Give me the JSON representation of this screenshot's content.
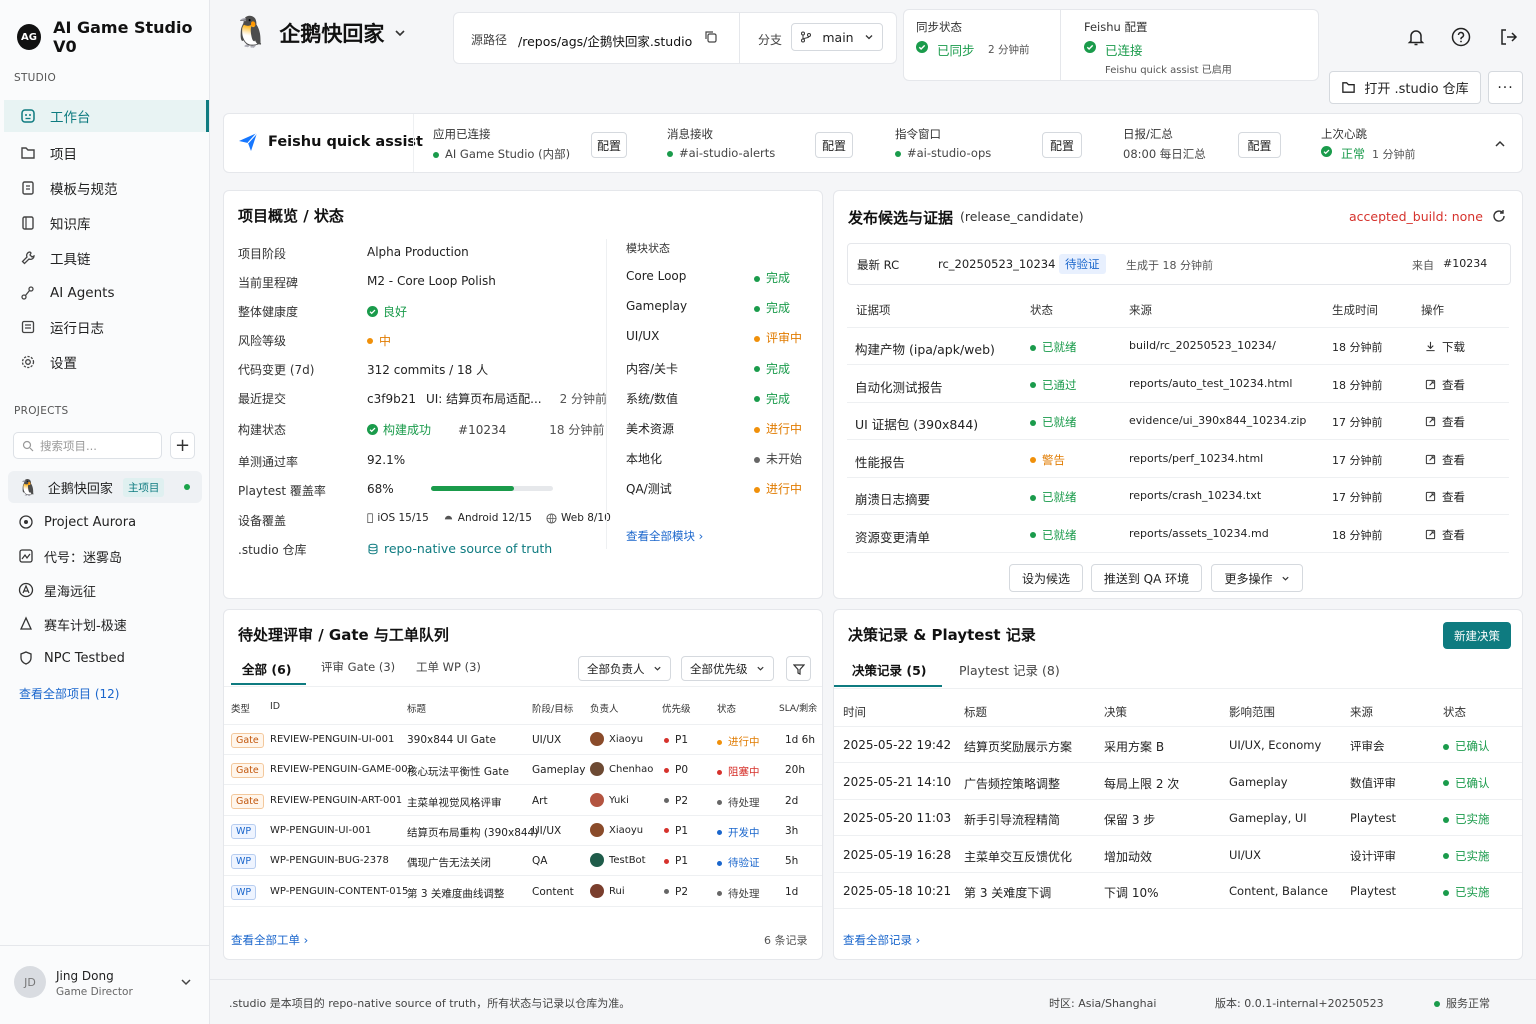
{
  "brand": {
    "logo": "AG",
    "name": "AI Game Studio V0"
  },
  "sidebar": {
    "studio_label": "STUDIO",
    "items": [
      {
        "label": "工作台",
        "icon": "dashboard-icon"
      },
      {
        "label": "项目",
        "icon": "folder-icon"
      },
      {
        "label": "模板与规范",
        "icon": "template-icon"
      },
      {
        "label": "知识库",
        "icon": "book-icon"
      },
      {
        "label": "工具链",
        "icon": "wrench-icon"
      },
      {
        "label": "AI Agents",
        "icon": "agent-icon"
      },
      {
        "label": "运行日志",
        "icon": "log-icon"
      },
      {
        "label": "设置",
        "icon": "gear-icon"
      }
    ],
    "projects_label": "PROJECTS",
    "search_placeholder": "搜索项目...",
    "projects": [
      {
        "name": "企鹅快回家",
        "tag": "主项目"
      },
      {
        "name": "Project Aurora"
      },
      {
        "name": "代号：迷雾岛"
      },
      {
        "name": "星海远征"
      },
      {
        "name": "赛车计划-极速"
      },
      {
        "name": "NPC Testbed"
      }
    ],
    "view_all": "查看全部项目 (12)",
    "user": {
      "initials": "JD",
      "name": "Jing Dong",
      "role": "Game Director"
    }
  },
  "header": {
    "project_title": "企鹅快回家",
    "source_label": "源路径",
    "source_path": "/repos/ags/企鹅快回家.studio",
    "branch_label": "分支",
    "branch": "main",
    "sync": {
      "label": "同步状态",
      "status": "已同步",
      "time": "2 分钟前"
    },
    "feishu": {
      "label": "Feishu 配置",
      "status": "已连接",
      "sub": "Feishu quick assist 已启用"
    },
    "open_repo": "打开 .studio 仓库"
  },
  "feishu_bar": {
    "title": "Feishu quick assist",
    "config_label": "配置",
    "items": [
      {
        "label": "应用已连接",
        "value": "AI Game Studio (内部)"
      },
      {
        "label": "消息接收",
        "value": "#ai-studio-alerts"
      },
      {
        "label": "指令窗口",
        "value": "#ai-studio-ops"
      },
      {
        "label": "日报/汇总",
        "value": "08:00 每日汇总"
      }
    ],
    "heartbeat": {
      "label": "上次心跳",
      "status": "正常",
      "time": "1 分钟前"
    }
  },
  "overview": {
    "title": "项目概览 / 状态",
    "rows": [
      {
        "k": "项目阶段",
        "v": "Alpha Production"
      },
      {
        "k": "当前里程碑",
        "v": "M2 - Core Loop Polish"
      },
      {
        "k": "整体健康度",
        "v": "良好"
      },
      {
        "k": "风险等级",
        "v": "中"
      },
      {
        "k": "代码变更 (7d)",
        "v": "312 commits / 18 人"
      },
      {
        "k": "最近提交",
        "v": "c3f9b21",
        "v2": "UI: 结算页布局适配...",
        "v3": "2 分钟前"
      },
      {
        "k": "构建状态",
        "v": "构建成功",
        "v2": "#10234",
        "v3": "18 分钟前"
      },
      {
        "k": "单测通过率",
        "v": "92.1%"
      },
      {
        "k": "Playtest 覆盖率",
        "v": "68%",
        "progress": 0.68
      },
      {
        "k": "设备覆盖",
        "v": "iOS 15/15",
        "v2": "Android 12/15",
        "v3": "Web 8/10"
      },
      {
        "k": ".studio 仓库",
        "v": "repo-native source of truth"
      }
    ],
    "modules_label": "模块状态",
    "modules": [
      {
        "name": "Core Loop",
        "status": "完成",
        "c": "green"
      },
      {
        "name": "Gameplay",
        "status": "完成",
        "c": "green"
      },
      {
        "name": "UI/UX",
        "status": "评审中",
        "c": "orange"
      },
      {
        "name": "内容/关卡",
        "status": "完成",
        "c": "green"
      },
      {
        "name": "系统/数值",
        "status": "完成",
        "c": "green"
      },
      {
        "name": "美术资源",
        "status": "进行中",
        "c": "orange"
      },
      {
        "name": "本地化",
        "status": "未开始",
        "c": "grey"
      },
      {
        "name": "QA/测试",
        "status": "进行中",
        "c": "orange"
      }
    ],
    "view_modules": "查看全部模块"
  },
  "release": {
    "title": "发布候选与证据",
    "title_sub": "(release_candidate)",
    "accepted": "accepted_build: none",
    "rc_label": "最新 RC",
    "rc_id": "rc_20250523_10234",
    "rc_badge": "待验证",
    "rc_gen": "生成于 18 分钟前",
    "rc_from": "来自",
    "rc_build": "#10234",
    "headers": [
      "证据项",
      "状态",
      "来源",
      "生成时间",
      "操作"
    ],
    "rows": [
      {
        "item": "构建产物 (ipa/apk/web)",
        "status": "已就绪",
        "c": "green",
        "src": "build/rc_20250523_10234/",
        "time": "18 分钟前",
        "op": "下载"
      },
      {
        "item": "自动化测试报告",
        "status": "已通过",
        "c": "green",
        "src": "reports/auto_test_10234.html",
        "time": "18 分钟前",
        "op": "查看"
      },
      {
        "item": "UI 证据包 (390x844)",
        "status": "已就绪",
        "c": "green",
        "src": "evidence/ui_390x844_10234.zip",
        "time": "17 分钟前",
        "op": "查看"
      },
      {
        "item": "性能报告",
        "status": "警告",
        "c": "orange",
        "src": "reports/perf_10234.html",
        "time": "17 分钟前",
        "op": "查看"
      },
      {
        "item": "崩溃日志摘要",
        "status": "已就绪",
        "c": "green",
        "src": "reports/crash_10234.txt",
        "time": "17 分钟前",
        "op": "查看"
      },
      {
        "item": "资源变更清单",
        "status": "已就绪",
        "c": "green",
        "src": "reports/assets_10234.md",
        "time": "18 分钟前",
        "op": "查看"
      }
    ],
    "btn_candidate": "设为候选",
    "btn_push": "推送到 QA 环境",
    "btn_more": "更多操作"
  },
  "queue": {
    "title": "待处理评审 / Gate 与工单队列",
    "tabs": [
      "全部 (6)",
      "评审 Gate (3)",
      "工单 WP (3)"
    ],
    "filter_owner": "全部负责人",
    "filter_priority": "全部优先级",
    "headers": [
      "类型",
      "ID",
      "标题",
      "阶段/目标",
      "负责人",
      "优先级",
      "状态",
      "SLA/剩余"
    ],
    "rows": [
      {
        "type": "Gate",
        "id": "REVIEW-PENGUIN-UI-001",
        "title": "390x844 UI Gate",
        "stage": "UI/UX",
        "owner": "Xiaoyu",
        "pri": "P1",
        "pc": "red",
        "status": "进行中",
        "sc": "orange",
        "sla": "1d 6h"
      },
      {
        "type": "Gate",
        "id": "REVIEW-PENGUIN-GAME-002",
        "title": "核心玩法平衡性 Gate",
        "stage": "Gameplay",
        "owner": "Chenhao",
        "pri": "P0",
        "pc": "red",
        "status": "阻塞中",
        "sc": "red",
        "sla": "20h"
      },
      {
        "type": "Gate",
        "id": "REVIEW-PENGUIN-ART-001",
        "title": "主菜单视觉风格评审",
        "stage": "Art",
        "owner": "Yuki",
        "pri": "P2",
        "pc": "grey",
        "status": "待处理",
        "sc": "grey",
        "sla": "2d"
      },
      {
        "type": "WP",
        "id": "WP-PENGUIN-UI-001",
        "title": "结算页布局重构 (390x844)",
        "stage": "UI/UX",
        "owner": "Xiaoyu",
        "pri": "P1",
        "pc": "red",
        "status": "开发中",
        "sc": "blue",
        "sla": "3h"
      },
      {
        "type": "WP",
        "id": "WP-PENGUIN-BUG-2378",
        "title": "偶现广告无法关闭",
        "stage": "QA",
        "owner": "TestBot",
        "pri": "P1",
        "pc": "red",
        "status": "待验证",
        "sc": "blue",
        "sla": "5h"
      },
      {
        "type": "WP",
        "id": "WP-PENGUIN-CONTENT-015",
        "title": "第 3 关难度曲线调整",
        "stage": "Content",
        "owner": "Rui",
        "pri": "P2",
        "pc": "grey",
        "status": "待处理",
        "sc": "grey",
        "sla": "1d"
      }
    ],
    "view_all": "查看全部工单",
    "count": "6 条记录"
  },
  "decisions": {
    "title": "决策记录 & Playtest 记录",
    "new_btn": "新建决策",
    "tabs": [
      "决策记录 (5)",
      "Playtest 记录 (8)"
    ],
    "headers": [
      "时间",
      "标题",
      "决策",
      "影响范围",
      "来源",
      "状态"
    ],
    "rows": [
      {
        "time": "2025-05-22 19:42",
        "title": "结算页奖励展示方案",
        "decision": "采用方案 B",
        "scope": "UI/UX, Economy",
        "src": "评审会",
        "status": "已确认"
      },
      {
        "time": "2025-05-21 14:10",
        "title": "广告频控策略调整",
        "decision": "每局上限 2 次",
        "scope": "Gameplay",
        "src": "数值评审",
        "status": "已确认"
      },
      {
        "time": "2025-05-20 11:03",
        "title": "新手引导流程精简",
        "decision": "保留 3 步",
        "scope": "Gameplay, UI",
        "src": "Playtest",
        "status": "已实施"
      },
      {
        "time": "2025-05-19 16:28",
        "title": "主菜单交互反馈优化",
        "decision": "增加动效",
        "scope": "UI/UX",
        "src": "设计评审",
        "status": "已实施"
      },
      {
        "time": "2025-05-18 10:21",
        "title": "第 3 关难度下调",
        "decision": "下调 10%",
        "scope": "Content, Balance",
        "src": "Playtest",
        "status": "已实施"
      }
    ],
    "view_all": "查看全部记录"
  },
  "footer": {
    "note": ".studio 是本项目的 repo-native source of truth，所有状态与记录以仓库为准。",
    "tz": "时区: Asia/Shanghai",
    "version": "版本: 0.0.1-internal+20250523",
    "service": "服务正常"
  }
}
